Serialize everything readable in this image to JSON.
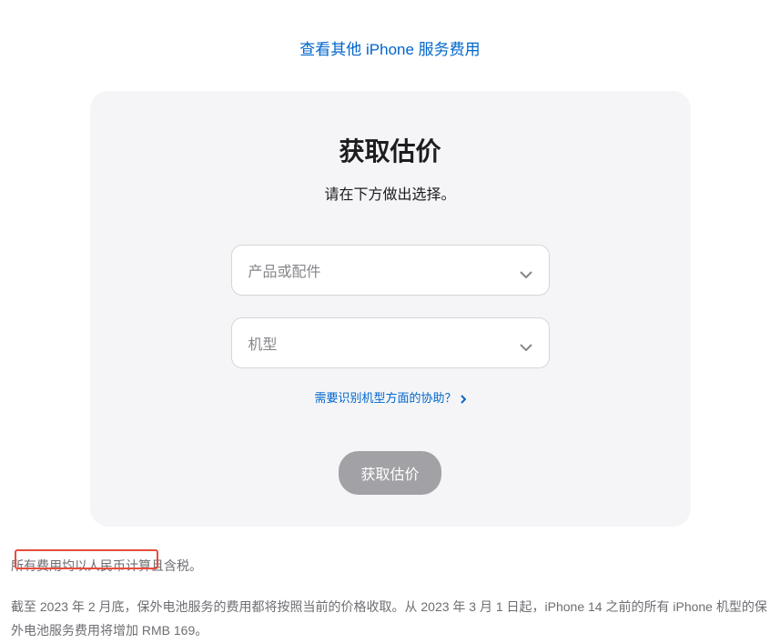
{
  "topLink": {
    "text": "查看其他 iPhone 服务费用"
  },
  "card": {
    "title": "获取估价",
    "subtitle": "请在下方做出选择。",
    "select1": {
      "placeholder": "产品或配件"
    },
    "select2": {
      "placeholder": "机型"
    },
    "helpLink": "需要识别机型方面的协助？",
    "button": "获取估价"
  },
  "footer": {
    "p1": "所有费用均以人民币计算且含税。",
    "p2": "截至 2023 年 2 月底，保外电池服务的费用都将按照当前的价格收取。从 2023 年 3 月 1 日起，iPhone 14 之前的所有 iPhone 机型的保外电池服务费用将增加 RMB 169。"
  }
}
